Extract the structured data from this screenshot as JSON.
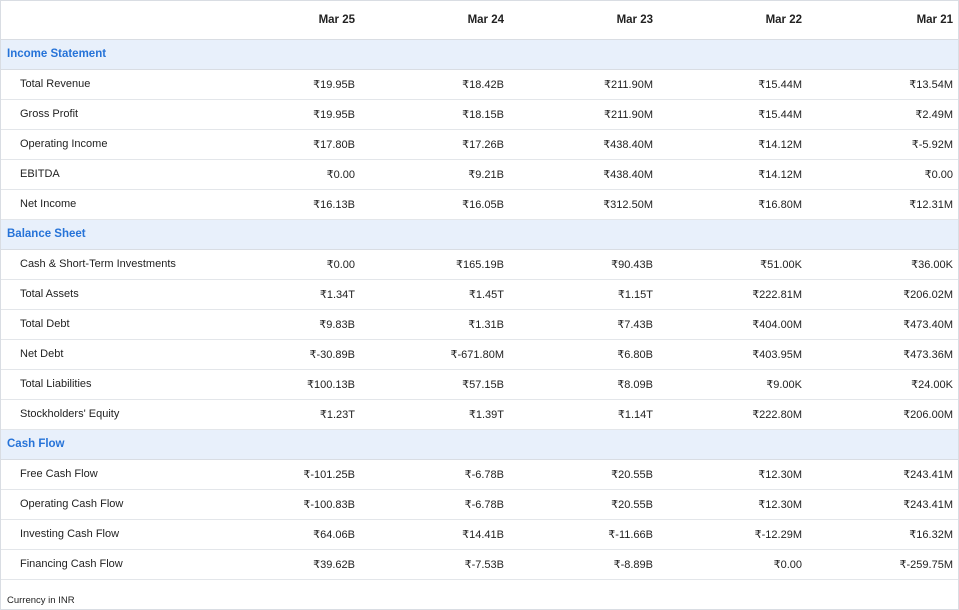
{
  "columns": [
    "Mar 25",
    "Mar 24",
    "Mar 23",
    "Mar 22",
    "Mar 21"
  ],
  "sections": [
    {
      "title": "Income Statement",
      "rows": [
        {
          "label": "Total Revenue",
          "values": [
            "₹19.95B",
            "₹18.42B",
            "₹211.90M",
            "₹15.44M",
            "₹13.54M"
          ]
        },
        {
          "label": "Gross Profit",
          "values": [
            "₹19.95B",
            "₹18.15B",
            "₹211.90M",
            "₹15.44M",
            "₹2.49M"
          ]
        },
        {
          "label": "Operating Income",
          "values": [
            "₹17.80B",
            "₹17.26B",
            "₹438.40M",
            "₹14.12M",
            "₹-5.92M"
          ]
        },
        {
          "label": "EBITDA",
          "values": [
            "₹0.00",
            "₹9.21B",
            "₹438.40M",
            "₹14.12M",
            "₹0.00"
          ]
        },
        {
          "label": "Net Income",
          "values": [
            "₹16.13B",
            "₹16.05B",
            "₹312.50M",
            "₹16.80M",
            "₹12.31M"
          ]
        }
      ]
    },
    {
      "title": "Balance Sheet",
      "rows": [
        {
          "label": "Cash & Short-Term Investments",
          "values": [
            "₹0.00",
            "₹165.19B",
            "₹90.43B",
            "₹51.00K",
            "₹36.00K"
          ]
        },
        {
          "label": "Total Assets",
          "values": [
            "₹1.34T",
            "₹1.45T",
            "₹1.15T",
            "₹222.81M",
            "₹206.02M"
          ]
        },
        {
          "label": "Total Debt",
          "values": [
            "₹9.83B",
            "₹1.31B",
            "₹7.43B",
            "₹404.00M",
            "₹473.40M"
          ]
        },
        {
          "label": "Net Debt",
          "values": [
            "₹-30.89B",
            "₹-671.80M",
            "₹6.80B",
            "₹403.95M",
            "₹473.36M"
          ]
        },
        {
          "label": "Total Liabilities",
          "values": [
            "₹100.13B",
            "₹57.15B",
            "₹8.09B",
            "₹9.00K",
            "₹24.00K"
          ]
        },
        {
          "label": "Stockholders' Equity",
          "values": [
            "₹1.23T",
            "₹1.39T",
            "₹1.14T",
            "₹222.80M",
            "₹206.00M"
          ]
        }
      ]
    },
    {
      "title": "Cash Flow",
      "rows": [
        {
          "label": "Free Cash Flow",
          "values": [
            "₹-101.25B",
            "₹-6.78B",
            "₹20.55B",
            "₹12.30M",
            "₹243.41M"
          ]
        },
        {
          "label": "Operating Cash Flow",
          "values": [
            "₹-100.83B",
            "₹-6.78B",
            "₹20.55B",
            "₹12.30M",
            "₹243.41M"
          ]
        },
        {
          "label": "Investing Cash Flow",
          "values": [
            "₹64.06B",
            "₹14.41B",
            "₹-11.66B",
            "₹-12.29M",
            "₹16.32M"
          ]
        },
        {
          "label": "Financing Cash Flow",
          "values": [
            "₹39.62B",
            "₹-7.53B",
            "₹-8.89B",
            "₹0.00",
            "₹-259.75M"
          ]
        }
      ]
    }
  ],
  "footer": "Currency in INR",
  "colors": {
    "section_bg": "#e8f0fb",
    "section_text": "#2673d8",
    "border": "#d9dde3"
  }
}
